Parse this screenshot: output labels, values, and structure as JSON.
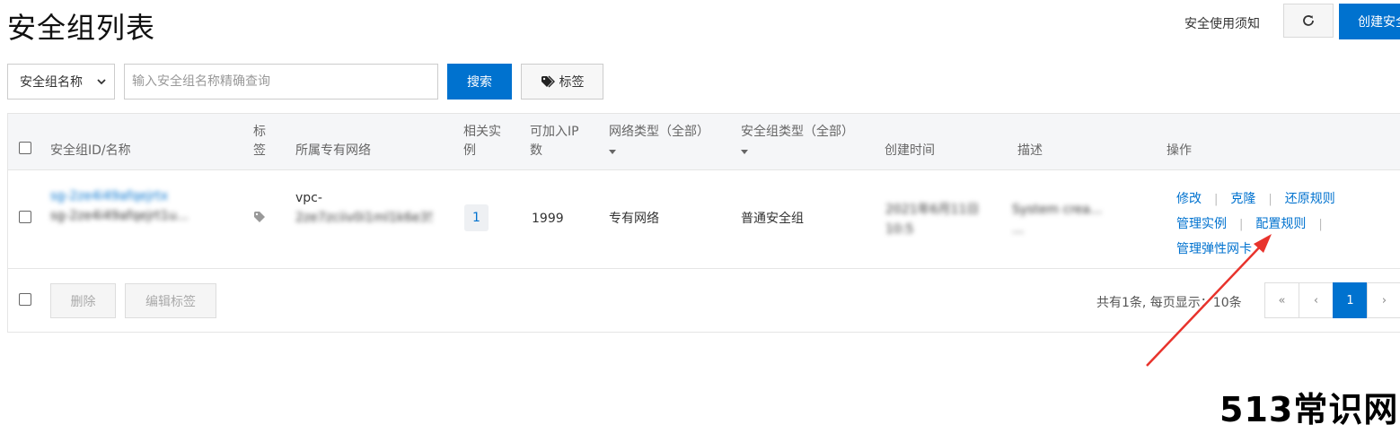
{
  "header": {
    "title": "安全组列表",
    "notice_link": "安全使用须知",
    "create_button": "创建安全组"
  },
  "filters": {
    "select_value": "安全组名称",
    "search_placeholder": "输入安全组名称精确查询",
    "search_button": "搜索",
    "tag_button": "标签"
  },
  "table": {
    "columns": {
      "id_name": "安全组ID/名称",
      "tag_line1": "标",
      "tag_line2": "签",
      "vpc": "所属专有网络",
      "instances_line1": "相关实",
      "instances_line2": "例",
      "ip_line1": "可加入IP",
      "ip_line2": "数",
      "network_type": "网络类型（全部）",
      "sg_type": "安全组类型（全部）",
      "created": "创建时间",
      "description": "描述",
      "actions": "操作"
    },
    "rows": [
      {
        "id_line1": "sg-2ze4i49afqejrtx",
        "id_line2": "sg-2ze4i49afqejrt1u...",
        "vpc_line1": "vpc-",
        "vpc_line2": "2ze7zciiv0i1ml1k6e35",
        "instances": "1",
        "ip_count": "1999",
        "network_type": "专有网络",
        "sg_type": "普通安全组",
        "created_line1": "2021年6月11日",
        "created_line2": "10:5",
        "desc_line1": "System crea...",
        "desc_line2": "...",
        "actions": {
          "modify": "修改",
          "clone": "克隆",
          "restore": "还原规则",
          "manage_instances": "管理实例",
          "config_rules": "配置规则",
          "manage_eni": "管理弹性网卡"
        }
      }
    ]
  },
  "footer": {
    "delete_button": "删除",
    "edit_tags_button": "编辑标签",
    "pager_info": "共有1条, 每页显示：10条",
    "pager_first": "«",
    "pager_prev": "‹",
    "pager_current": "1",
    "pager_next": "›"
  },
  "watermark": "513常识网",
  "colors": {
    "primary": "#0072cf",
    "arrow": "#e8332c"
  },
  "icons": {
    "refresh": "refresh-icon",
    "tag": "tag-icon",
    "dropdown": "chevron-down-icon"
  }
}
